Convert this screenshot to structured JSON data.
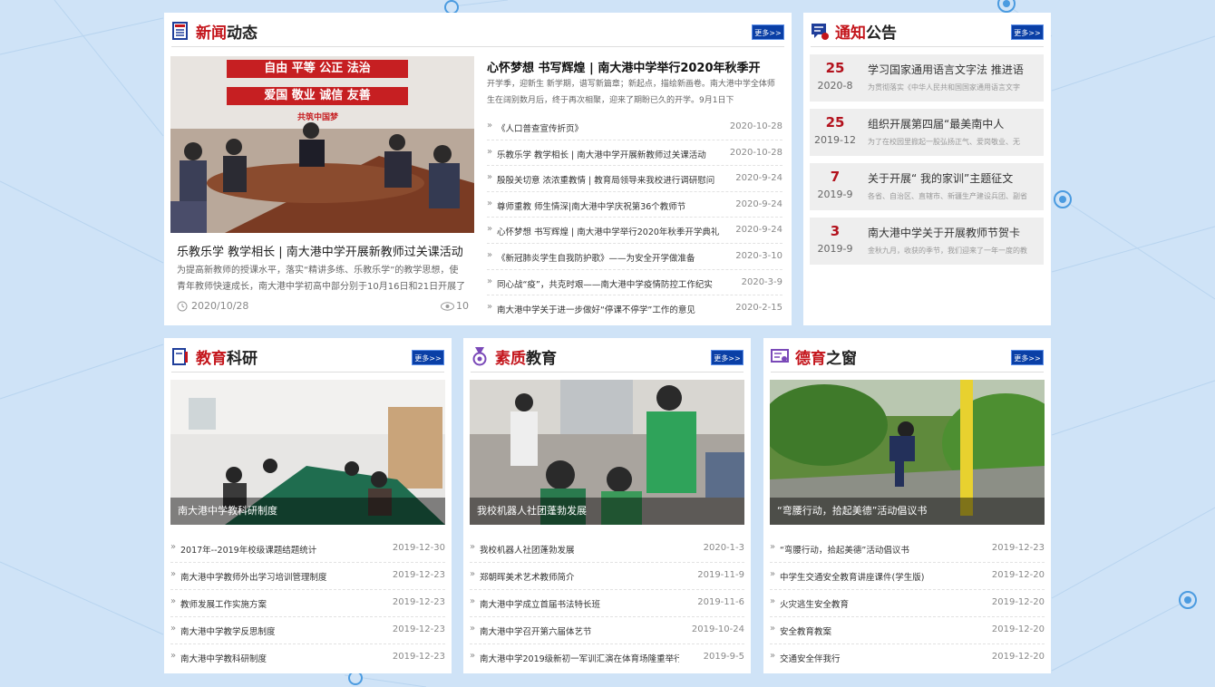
{
  "news": {
    "title_red": "新闻",
    "title_rest": "动态",
    "more": "更多>>",
    "lead": {
      "slogan_1": "自由  平等  公正  法治",
      "slogan_2": "爱国  敬业  诚信  友善",
      "slogan_3": "共筑中国梦",
      "title": "乐教乐学 教学相长 | 南大港中学开展新教师过关课活动",
      "summary": "为提高新教师的授课水平，落实“精讲多练、乐教乐学”的教学思想，使青年教师快速成长，南大港中学初高中部分别于10月16日和21日开展了",
      "date": "2020/10/28",
      "views": "10"
    },
    "featured": {
      "title": "心怀梦想 书写辉煌 | 南大港中学举行2020年秋季开",
      "summary": "开学季，迎新生 新学期，谱写新篇章；新起点，描绘新画卷。南大港中学全体师生在阔别数月后，终于再次相聚，迎来了期盼已久的开学。9月1日下"
    },
    "items": [
      {
        "bullet": "»",
        "title": "《人口普查宣传折页》",
        "date": "2020-10-28"
      },
      {
        "bullet": "»",
        "title": "乐教乐学 教学相长 | 南大港中学开展新教师过关课活动",
        "date": "2020-10-28"
      },
      {
        "bullet": "»",
        "title": "殷殷关切意 浓浓重教情 | 教育局领导来我校进行调研慰问",
        "date": "2020-9-24"
      },
      {
        "bullet": "»",
        "title": "尊师重教 师生情深|南大港中学庆祝第36个教师节",
        "date": "2020-9-24"
      },
      {
        "bullet": "»",
        "title": "心怀梦想 书写辉煌 | 南大港中学举行2020年秋季开学典礼",
        "date": "2020-9-24"
      },
      {
        "bullet": "»",
        "title": "《新冠肺炎学生自我防护歌》——为安全开学做准备",
        "date": "2020-3-10"
      },
      {
        "bullet": "»",
        "title": "同心战“疫”，共克时艰——南大港中学疫情防控工作纪实",
        "date": "2020-3-9"
      },
      {
        "bullet": "»",
        "title": "南大港中学关于进一步做好“停课不停学”工作的意见",
        "date": "2020-2-15"
      }
    ]
  },
  "notices": {
    "title_red": "通知",
    "title_rest": "公告",
    "more": "更多>>",
    "items": [
      {
        "day": "25",
        "ym": "2020-8",
        "title": "学习国家通用语言文字法   推进语",
        "summary": "为贯彻落实《中华人民共和国国家通用语言文字"
      },
      {
        "day": "25",
        "ym": "2019-12",
        "title": "组织开展第四届“最美南中人",
        "summary": "为了在校园里掀起一股弘扬正气、爱岗敬业、无"
      },
      {
        "day": "7",
        "ym": "2019-9",
        "title": "关于开展“ 我的家训”主题征文",
        "summary": "各省、自治区、直辖市、新疆生产建设兵团、副省"
      },
      {
        "day": "3",
        "ym": "2019-9",
        "title": "南大港中学关于开展教师节贺卡",
        "summary": "金秋九月，收获的季节，我们迎来了一年一度的教"
      }
    ]
  },
  "research": {
    "title_red": "教育",
    "title_rest": "科研",
    "more": "更多>>",
    "caption": "南大港中学教科研制度",
    "items": [
      {
        "bullet": "»",
        "title": "2017年--2019年校级课题结题统计",
        "date": "2019-12-30"
      },
      {
        "bullet": "»",
        "title": "南大港中学教师外出学习培训管理制度",
        "date": "2019-12-23"
      },
      {
        "bullet": "»",
        "title": "教师发展工作实施方案",
        "date": "2019-12-23"
      },
      {
        "bullet": "»",
        "title": "南大港中学教学反思制度",
        "date": "2019-12-23"
      },
      {
        "bullet": "»",
        "title": "南大港中学教科研制度",
        "date": "2019-12-23"
      }
    ]
  },
  "quality": {
    "title_red": "素质",
    "title_rest": "教育",
    "more": "更多>>",
    "caption": "我校机器人社团蓬勃发展",
    "items": [
      {
        "bullet": "»",
        "title": "我校机器人社团蓬勃发展",
        "date": "2020-1-3"
      },
      {
        "bullet": "»",
        "title": "郑朝晖美术艺术教师简介",
        "date": "2019-11-9"
      },
      {
        "bullet": "»",
        "title": "南大港中学成立首届书法特长班",
        "date": "2019-11-6"
      },
      {
        "bullet": "»",
        "title": "南大港中学召开第六届体艺节",
        "date": "2019-10-24"
      },
      {
        "bullet": "»",
        "title": "南大港中学2019级新初一军训汇演在体育场隆重举行",
        "date": "2019-9-5"
      }
    ]
  },
  "moral": {
    "title_red": "德育",
    "title_rest": "之窗",
    "more": "更多>>",
    "caption": "“弯腰行动，拾起美德”活动倡议书",
    "items": [
      {
        "bullet": "»",
        "title": "“弯腰行动，拾起美德”活动倡议书",
        "date": "2019-12-23"
      },
      {
        "bullet": "»",
        "title": "中学生交通安全教育讲座课件(学生版)",
        "date": "2019-12-20"
      },
      {
        "bullet": "»",
        "title": "火灾逃生安全教育",
        "date": "2019-12-20"
      },
      {
        "bullet": "»",
        "title": "安全教育教案",
        "date": "2019-12-20"
      },
      {
        "bullet": "»",
        "title": "交通安全伴我行",
        "date": "2019-12-20"
      }
    ]
  },
  "colors": {
    "accent_red": "#c4161c",
    "more_button_blue": "#0a3fa6",
    "background": "#cfe3f7"
  }
}
